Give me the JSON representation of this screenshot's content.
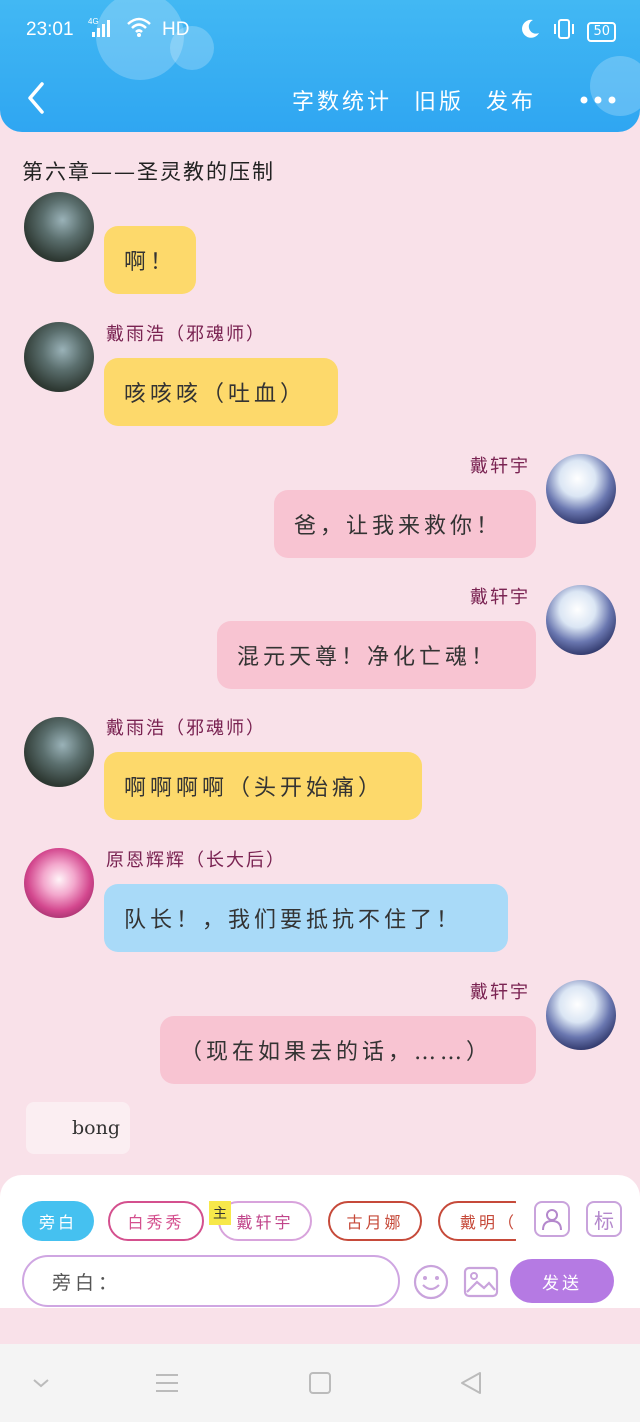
{
  "status_bar": {
    "time": "23:01",
    "network": "4G",
    "hd": "HD",
    "battery": "50"
  },
  "toolbar": {
    "word_count": "字数统计",
    "old_version": "旧版",
    "publish": "发布"
  },
  "chapter_title": "第六章——圣灵教的压制",
  "messages": [
    {
      "side": "left",
      "name": "",
      "text": "啊！",
      "color": "#fdd96b"
    },
    {
      "side": "left",
      "name": "戴雨浩（邪魂师）",
      "text": "咳咳咳（吐血）",
      "color": "#fdd96b"
    },
    {
      "side": "right",
      "name": "戴轩宇",
      "text": "爸，让我来救你！",
      "color": "#f8c4d2"
    },
    {
      "side": "right",
      "name": "戴轩宇",
      "text": "混元天尊！净化亡魂！",
      "color": "#f8c4d2"
    },
    {
      "side": "left",
      "name": "戴雨浩（邪魂师）",
      "text": "啊啊啊啊（头开始痛）",
      "color": "#fdd96b"
    },
    {
      "side": "left",
      "name": "原恩辉辉（长大后）",
      "text": "队长！，我们要抵抗不住了！",
      "color": "#a9daf8"
    },
    {
      "side": "right",
      "name": "戴轩宇",
      "text": "（现在如果去的话，……）",
      "color": "#f8c4d2"
    }
  ],
  "narration": {
    "text": "bong"
  },
  "roles": {
    "narration": "旁白",
    "items": [
      "白秀秀",
      "戴轩宇",
      "古月娜",
      "戴明（"
    ],
    "main_tag": "主"
  },
  "tools": {
    "tag_label": "标"
  },
  "input": {
    "prefix": "旁白：",
    "value": ""
  },
  "send_label": "发送",
  "colors": {
    "header": "#2fa6f2",
    "background": "#f9e1e9",
    "send": "#b57ae3"
  }
}
